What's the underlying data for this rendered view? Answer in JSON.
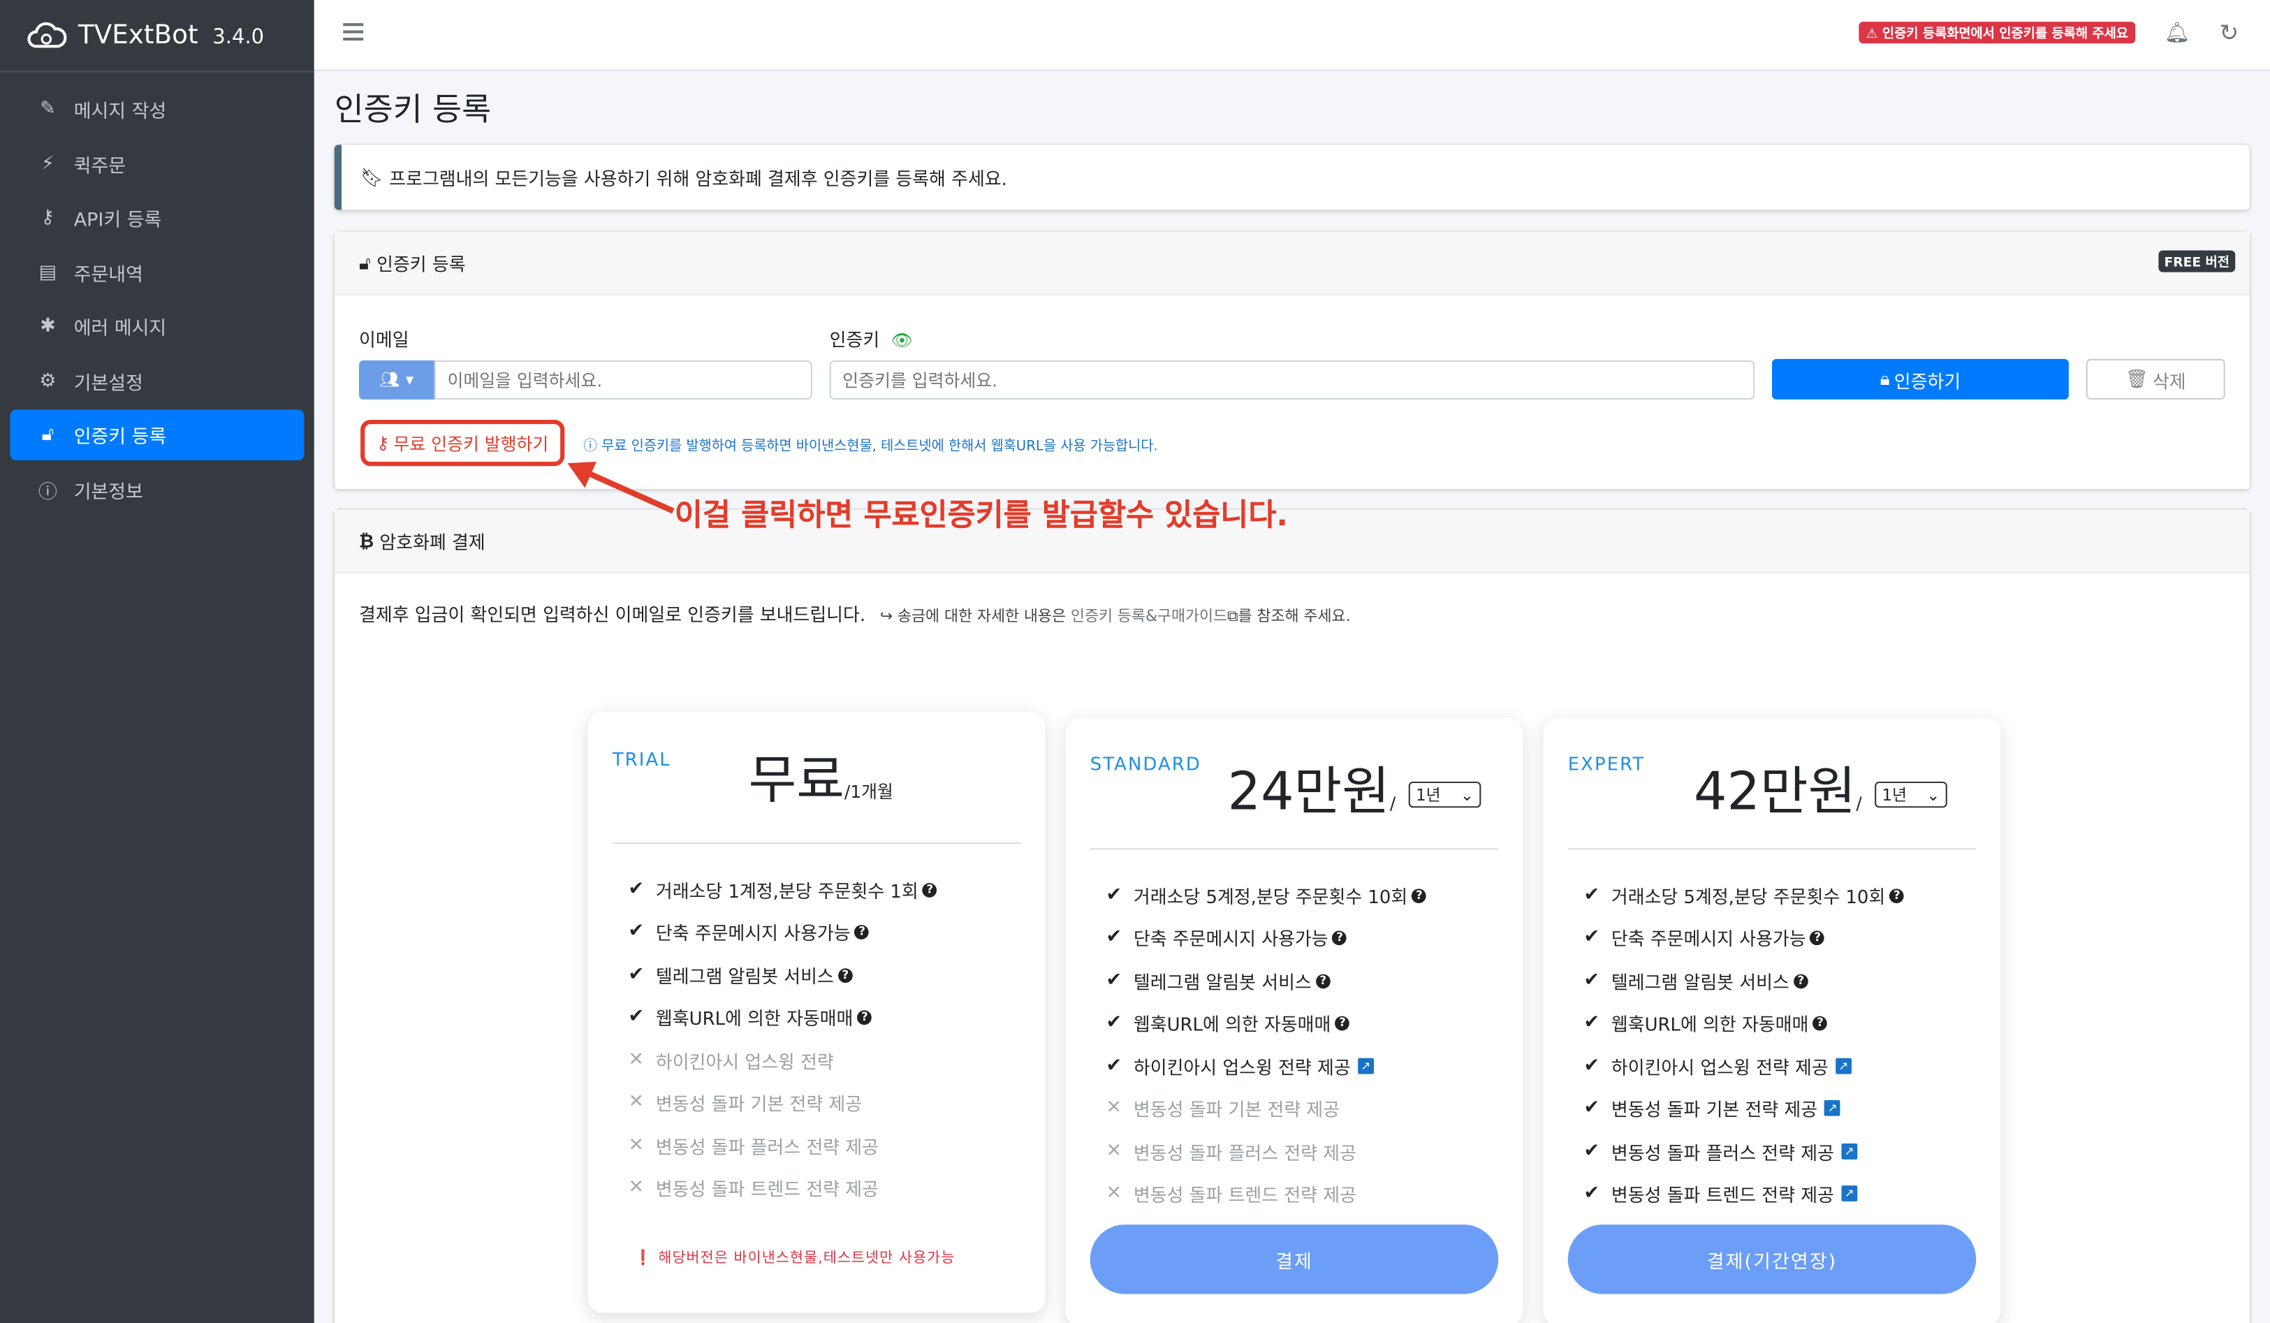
{
  "app": {
    "name": "TVExtBot",
    "version": "3.4.0"
  },
  "sidebar": {
    "items": [
      {
        "label": "메시지 작성",
        "icon": "edit-icon"
      },
      {
        "label": "퀵주문",
        "icon": "bolt-icon"
      },
      {
        "label": "API키 등록",
        "icon": "key-icon"
      },
      {
        "label": "주문내역",
        "icon": "book-icon"
      },
      {
        "label": "에러 메시지",
        "icon": "bug-icon"
      },
      {
        "label": "기본설정",
        "icon": "gears-icon"
      },
      {
        "label": "인증키 등록",
        "icon": "unlock-icon",
        "active": true
      },
      {
        "label": "기본정보",
        "icon": "info-icon"
      }
    ]
  },
  "topbar": {
    "warning": "인증키 등록화면에서 인증키를 등록해 주세요"
  },
  "page": {
    "title": "인증키 등록"
  },
  "callout": {
    "text": "프로그램내의 모든기능을 사용하기 위해 암호화폐 결제후 인증키를 등록해 주세요."
  },
  "auth_card": {
    "title": "인증키 등록",
    "badge": "FREE 버전",
    "email_label": "이메일",
    "email_placeholder": "이메일을 입력하세요.",
    "key_label": "인증키",
    "key_placeholder": "인증키를 입력하세요.",
    "auth_button": "인증하기",
    "delete_button": "삭제",
    "free_link": "무료 인증키 발행하기",
    "free_note": "무료 인증키를 발행하여 등록하면 바이낸스현물, 테스트넷에 한해서 웹훅URL을 사용 가능합니다."
  },
  "annotation": "이걸 클릭하면 무료인증키를 발급할수 있습니다.",
  "pay_card": {
    "title": "암호화폐 결제",
    "text": "결제후 입금이 확인되면 입력하신 이메일로 인증키를 보내드립니다.",
    "sub_pre": "송금에 대한 자세한 내용은",
    "sub_link": "인증키 등록&구매가이드",
    "sub_post": "를 참조해 주세요."
  },
  "plans": [
    {
      "name": "TRIAL",
      "price": "무료",
      "unit": "/1개월",
      "select": "",
      "features": [
        {
          "text": "거래소당 1계정,분당 주문횟수 1회",
          "on": true,
          "mark": "q"
        },
        {
          "text": "단축 주문메시지 사용가능",
          "on": true,
          "mark": "q"
        },
        {
          "text": "텔레그램 알림봇 서비스",
          "on": true,
          "mark": "q"
        },
        {
          "text": "웹훅URL에 의한 자동매매",
          "on": true,
          "mark": "q"
        },
        {
          "text": "하이킨아시 업스윙 전략",
          "on": false,
          "mark": ""
        },
        {
          "text": "변동성 돌파 기본 전략 제공",
          "on": false,
          "mark": ""
        },
        {
          "text": "변동성 돌파 플러스 전략 제공",
          "on": false,
          "mark": ""
        },
        {
          "text": "변동성 돌파 트렌드 전략 제공",
          "on": false,
          "mark": ""
        }
      ],
      "note": "해당버전은 바이낸스현물,테스트넷만 사용가능",
      "button": ""
    },
    {
      "name": "STANDARD",
      "price": "24만원",
      "unit": "/",
      "select": "1년",
      "features": [
        {
          "text": "거래소당 5계정,분당 주문횟수 10회",
          "on": true,
          "mark": "q"
        },
        {
          "text": "단축 주문메시지 사용가능",
          "on": true,
          "mark": "q"
        },
        {
          "text": "텔레그램 알림봇 서비스",
          "on": true,
          "mark": "q"
        },
        {
          "text": "웹훅URL에 의한 자동매매",
          "on": true,
          "mark": "q"
        },
        {
          "text": "하이킨아시 업스윙 전략 제공",
          "on": true,
          "mark": "ext"
        },
        {
          "text": "변동성 돌파 기본 전략 제공",
          "on": false,
          "mark": ""
        },
        {
          "text": "변동성 돌파 플러스 전략 제공",
          "on": false,
          "mark": ""
        },
        {
          "text": "변동성 돌파 트렌드 전략 제공",
          "on": false,
          "mark": ""
        }
      ],
      "note": "",
      "button": "결제"
    },
    {
      "name": "EXPERT",
      "price": "42만원",
      "unit": "/",
      "select": "1년",
      "features": [
        {
          "text": "거래소당 5계정,분당 주문횟수 10회",
          "on": true,
          "mark": "q"
        },
        {
          "text": "단축 주문메시지 사용가능",
          "on": true,
          "mark": "q"
        },
        {
          "text": "텔레그램 알림봇 서비스",
          "on": true,
          "mark": "q"
        },
        {
          "text": "웹훅URL에 의한 자동매매",
          "on": true,
          "mark": "q"
        },
        {
          "text": "하이킨아시 업스윙 전략 제공",
          "on": true,
          "mark": "ext"
        },
        {
          "text": "변동성 돌파 기본 전략 제공",
          "on": true,
          "mark": "ext"
        },
        {
          "text": "변동성 돌파 플러스 전략 제공",
          "on": true,
          "mark": "ext"
        },
        {
          "text": "변동성 돌파 트렌드 전략 제공",
          "on": true,
          "mark": "ext"
        }
      ],
      "note": "",
      "button": "결제(기간연장)"
    }
  ],
  "colors": {
    "sidebar": "#343a40",
    "primary": "#007bff",
    "annotation": "#e23c2a",
    "plan_button": "#6c9ef7"
  }
}
